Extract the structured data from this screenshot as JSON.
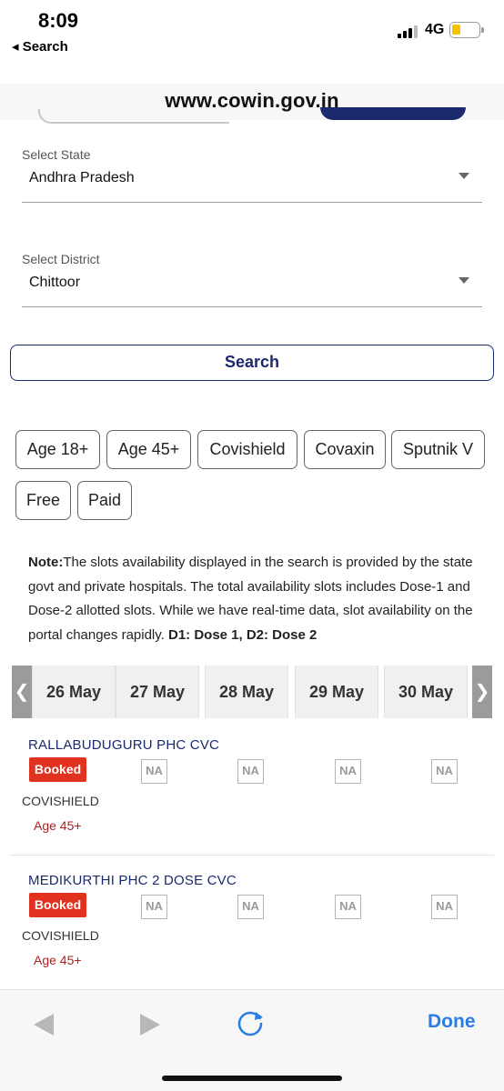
{
  "status_bar": {
    "time": "8:09",
    "back_label": "◂ Search",
    "network": "4G"
  },
  "browser": {
    "url": "www.cowin.gov.in",
    "done_label": "Done"
  },
  "form": {
    "state_label": "Select State",
    "state_value": "Andhra Pradesh",
    "district_label": "Select District",
    "district_value": "Chittoor",
    "search_label": "Search"
  },
  "filters": [
    "Age 18+",
    "Age 45+",
    "Covishield",
    "Covaxin",
    "Sputnik V",
    "Free",
    "Paid"
  ],
  "note": {
    "prefix": "Note:",
    "text": "The slots availability displayed in the search is provided by the state govt and private hospitals. The total availability slots includes Dose-1 and Dose-2 allotted slots. While we have real-time data, slot availability on the portal changes rapidly. ",
    "dose_legend": "D1: Dose 1, D2: Dose 2"
  },
  "dates": [
    "26 May",
    "27 May",
    "28 May",
    "29 May",
    "30 May"
  ],
  "centers": [
    {
      "name": "RALLABUDUGURU PHC CVC",
      "slots": [
        "Booked",
        "NA",
        "NA",
        "NA",
        "NA"
      ],
      "vaccine": "COVISHIELD",
      "age": "Age 45+"
    },
    {
      "name": "MEDIKURTHI PHC 2 DOSE CVC",
      "slots": [
        "Booked",
        "NA",
        "NA",
        "NA",
        "NA"
      ],
      "vaccine": "COVISHIELD",
      "age": "Age 45+"
    }
  ],
  "colors": {
    "brand_navy": "#1a2a6c",
    "booked_red": "#e0321f",
    "age_red": "#b21f1f",
    "ios_blue": "#2b7de1"
  }
}
